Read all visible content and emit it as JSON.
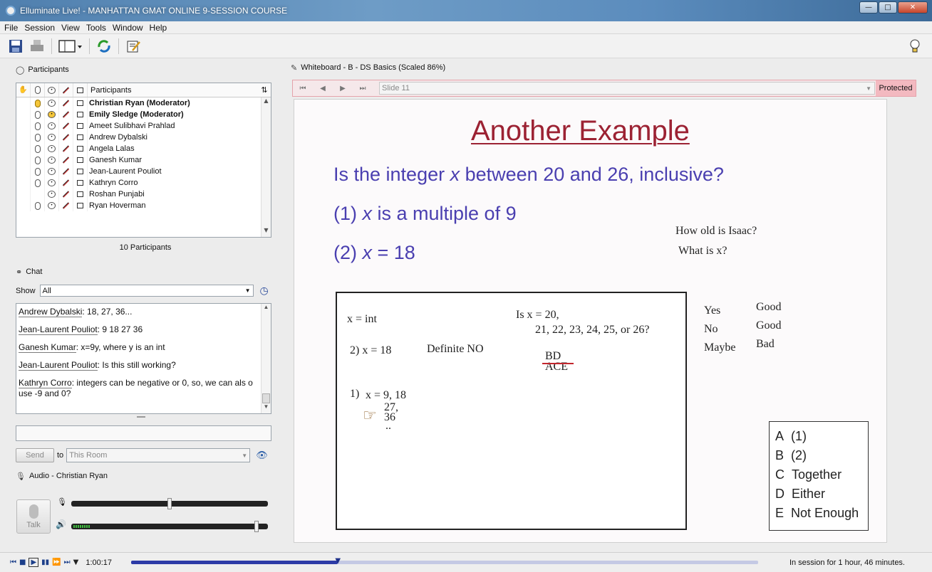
{
  "window": {
    "title": "Elluminate Live! - MANHATTAN GMAT ONLINE 9-SESSION COURSE"
  },
  "menu": [
    "File",
    "Session",
    "View",
    "Tools",
    "Window",
    "Help"
  ],
  "participants": {
    "title": "Participants",
    "column_header": "Participants",
    "count_label": "10 Participants",
    "rows": [
      {
        "name": "Christian Ryan (Moderator)",
        "moderator": true,
        "mic": true,
        "mic_active": true,
        "speaker_active": false
      },
      {
        "name": "Emily Sledge (Moderator)",
        "moderator": true,
        "mic": true,
        "mic_active": false,
        "speaker_active": true
      },
      {
        "name": "Ameet Sulibhavi Prahlad",
        "moderator": false,
        "mic": true
      },
      {
        "name": "Andrew Dybalski",
        "moderator": false,
        "mic": true
      },
      {
        "name": "Angela Lalas",
        "moderator": false,
        "mic": true
      },
      {
        "name": "Ganesh Kumar",
        "moderator": false,
        "mic": true
      },
      {
        "name": "Jean-Laurent Pouliot",
        "moderator": false,
        "mic": true
      },
      {
        "name": "Kathryn Corro",
        "moderator": false,
        "mic": true
      },
      {
        "name": "Roshan Punjabi",
        "moderator": false,
        "mic": false
      },
      {
        "name": "Ryan Hoverman",
        "moderator": false,
        "mic": true
      }
    ]
  },
  "chat": {
    "title": "Chat",
    "show_label": "Show",
    "show_value": "All",
    "messages": [
      {
        "author": "Andrew Dybalski",
        "text": ": 18, 27, 36..."
      },
      {
        "author": "Jean-Laurent Pouliot",
        "text": ": 9 18 27 36"
      },
      {
        "author": "Ganesh Kumar",
        "text": ": x=9y, where y is an int"
      },
      {
        "author": "Jean-Laurent Pouliot",
        "text": ": Is this still working?"
      },
      {
        "author": "Kathryn Corro",
        "text": ": integers can be negative or 0, so, we can als o use -9 and 0?"
      }
    ],
    "input_value": "",
    "send_label": "Send",
    "to_label": "to",
    "to_value": "This Room"
  },
  "audio": {
    "title": "Audio - Christian Ryan",
    "talk_label": "Talk",
    "mic_level": 0.5,
    "speaker_level": 0.95
  },
  "whiteboard": {
    "title": "Whiteboard - B - DS Basics (Scaled 86%)",
    "slide_value": "Slide 11",
    "protected_label": "Protected",
    "heading": "Another Example",
    "question_pre": "Is the integer ",
    "question_var": "x",
    "question_post": " between 20 and 26, inclusive?",
    "stmt1_num": "(1) ",
    "stmt1_var": "x",
    "stmt1_rest": " is a multiple of 9",
    "stmt2_num": "(2) ",
    "stmt2_var": "x",
    "stmt2_rest": " = 18",
    "note1": "How old is Isaac?",
    "note2": "What is x?",
    "box": {
      "x_int": "x = int",
      "s2": "2)  x = 18",
      "definite": "Definite NO",
      "is_x": "Is x = 20,",
      "is_x2": "21, 22, 23, 24, 25, or 26?",
      "bd": "BD",
      "ace": "ACE",
      "s1_num": "1)",
      "s1": "x = 9, 18",
      "v27": "27,",
      "v36": "36",
      "dots": ".."
    },
    "ratings": [
      {
        "label": "Yes",
        "grade": "Good"
      },
      {
        "label": "No",
        "grade": "Good"
      },
      {
        "label": "Maybe",
        "grade": "Bad"
      }
    ],
    "options": [
      {
        "letter": "A",
        "text": "(1)"
      },
      {
        "letter": "B",
        "text": "(2)"
      },
      {
        "letter": "C",
        "text": "Together"
      },
      {
        "letter": "D",
        "text": "Either"
      },
      {
        "letter": "E",
        "text": "Not Enough"
      }
    ]
  },
  "status": {
    "time": "1:00:17",
    "progress": 0.33,
    "session_text": "In session for 1 hour, 46 minutes."
  }
}
